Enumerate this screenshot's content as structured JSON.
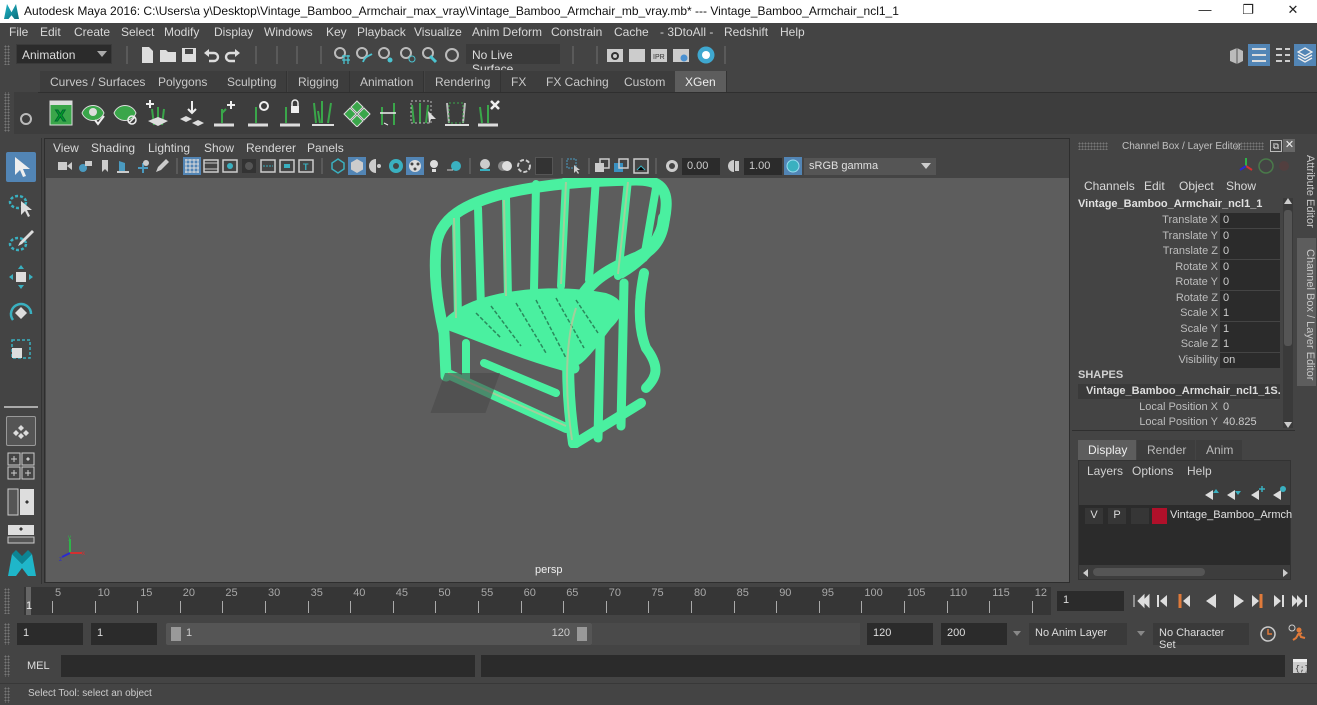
{
  "window": {
    "title": "Autodesk Maya 2016: C:\\Users\\a y\\Desktop\\Vintage_Bamboo_Armchair_max_vray\\Vintage_Bamboo_Armchair_mb_vray.mb*  ---  Vintage_Bamboo_Armchair_ncl1_1",
    "minimize": "—",
    "restore": "❐",
    "close": "✕"
  },
  "menubar": [
    "File",
    "Edit",
    "Create",
    "Select",
    "Modify",
    "Display",
    "Windows",
    "Key",
    "Playback",
    "Visualize",
    "Anim Deform",
    "Constrain",
    "Cache",
    "- 3DtoAll -",
    "Redshift",
    "Help"
  ],
  "statusline": {
    "menuset": "Animation",
    "live_surface": "No Live Surface"
  },
  "shelf": {
    "tabs": [
      "Curves / Surfaces",
      "Polygons",
      "Sculpting",
      "Rigging",
      "Animation",
      "Rendering",
      "FX",
      "FX Caching",
      "Custom",
      "XGen"
    ],
    "active_tab": "XGen",
    "icons": [
      "xgen-editor-icon",
      "xgen-toggle-preview-icon",
      "xgen-hide-preview-icon",
      "xgen-add-guide-icon",
      "xgen-place-guide-icon",
      "xgen-add-guides-icon",
      "xgen-sculpt-guide-icon",
      "xgen-lock-guide-icon",
      "xgen-guides-icon",
      "xgen-description-icon",
      "xgen-attract-icon",
      "xgen-select-guides-icon",
      "xgen-frame-icon",
      "xgen-delete-guide-icon"
    ]
  },
  "viewport": {
    "menus": [
      "View",
      "Shading",
      "Lighting",
      "Show",
      "Renderer",
      "Panels"
    ],
    "exposure": "0.00",
    "gamma": "1.00",
    "color_space": "sRGB gamma",
    "camera_label": "persp",
    "axis": {
      "x": "x",
      "y": "y",
      "z": "z"
    }
  },
  "channel_box": {
    "header": "Channel Box / Layer Editor",
    "menus": [
      "Channels",
      "Edit",
      "Object",
      "Show"
    ],
    "object_name": "Vintage_Bamboo_Armchair_ncl1_1",
    "channels": [
      {
        "label": "Translate X",
        "value": "0"
      },
      {
        "label": "Translate Y",
        "value": "0"
      },
      {
        "label": "Translate Z",
        "value": "0"
      },
      {
        "label": "Rotate X",
        "value": "0"
      },
      {
        "label": "Rotate Y",
        "value": "0"
      },
      {
        "label": "Rotate Z",
        "value": "0"
      },
      {
        "label": "Scale X",
        "value": "1"
      },
      {
        "label": "Scale Y",
        "value": "1"
      },
      {
        "label": "Scale Z",
        "value": "1"
      },
      {
        "label": "Visibility",
        "value": "on"
      }
    ],
    "shapes_header": "SHAPES",
    "shape_name": "Vintage_Bamboo_Armchair_ncl1_1S...",
    "shape_channels": [
      {
        "label": "Local Position X",
        "value": "0"
      },
      {
        "label": "Local Position Y",
        "value": "40.825"
      }
    ]
  },
  "layer_editor": {
    "tabs": [
      "Display",
      "Render",
      "Anim"
    ],
    "active_tab": "Display",
    "menus": [
      "Layers",
      "Options",
      "Help"
    ],
    "layers": [
      {
        "v": "V",
        "p": "P",
        "color": "#b0102a",
        "name": "Vintage_Bamboo_Armch"
      }
    ]
  },
  "side_tabs": [
    "Attribute Editor",
    "Channel Box / Layer Editor"
  ],
  "timeline": {
    "ticks": [
      5,
      10,
      15,
      20,
      25,
      30,
      35,
      40,
      45,
      50,
      55,
      60,
      65,
      70,
      75,
      80,
      85,
      90,
      95,
      100,
      105,
      110,
      115,
      "12"
    ],
    "current_frame_marker": "1",
    "current_frame": "1"
  },
  "range": {
    "start": "1",
    "anim_start": "1",
    "slider_start": "1",
    "slider_end": "120",
    "anim_end": "120",
    "end": "200",
    "anim_layer": "No Anim Layer",
    "character_set": "No Character Set"
  },
  "command_line": {
    "label": "MEL",
    "input": "",
    "result": ""
  },
  "help_line": "Select Tool: select an object",
  "colors": {
    "accent_blue": "#5285b5",
    "selection_green": "#4af0a0",
    "layer_color": "#b0102a",
    "key_orange": "#e07a3a"
  }
}
